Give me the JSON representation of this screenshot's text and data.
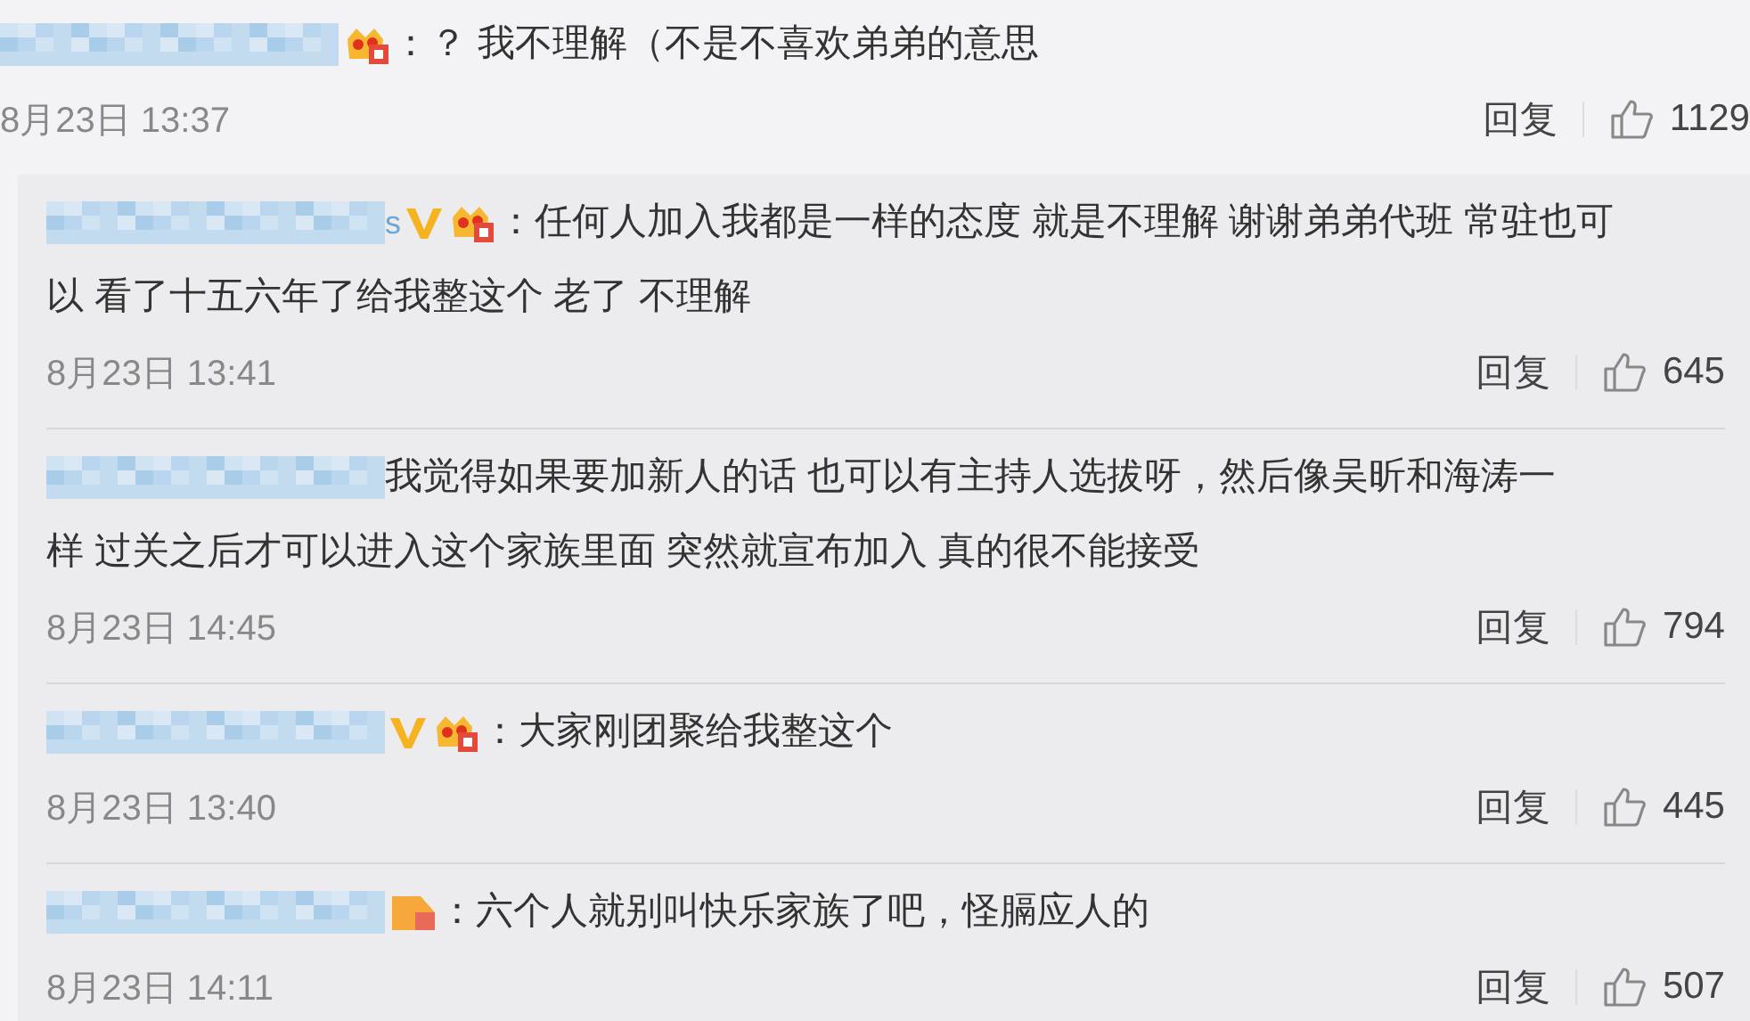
{
  "comment": {
    "badges": [
      {
        "kind": "crown"
      }
    ],
    "lines": [
      "：？ 我不理解（不是不喜欢弟弟的意思"
    ],
    "time": "8月23日 13:37",
    "reply_label": "回复",
    "likes": "1129"
  },
  "replies": [
    {
      "name_tail": "s",
      "badges": [
        {
          "kind": "verified"
        },
        {
          "kind": "crown"
        }
      ],
      "lines": [
        "：任何人加入我都是一样的态度 就是不理解 谢谢弟弟代班 常驻也可",
        "以 看了十五六年了给我整这个 老了 不理解"
      ],
      "time": "8月23日 13:41",
      "reply_label": "回复",
      "likes": "645"
    },
    {
      "lines": [
        "我觉得如果要加新人的话 也可以有主持人选拔呀，然后像吴昕和海涛一",
        "样 过关之后才可以进入这个家族里面 突然就宣布加入 真的很不能接受"
      ],
      "time": "8月23日 14:45",
      "reply_label": "回复",
      "likes": "794"
    },
    {
      "badges": [
        {
          "kind": "verified"
        },
        {
          "kind": "crown"
        }
      ],
      "lines": [
        "：大家刚团聚给我整这个"
      ],
      "time": "8月23日 13:40",
      "reply_label": "回复",
      "likes": "445"
    },
    {
      "badges": [
        {
          "kind": "member"
        }
      ],
      "lines": [
        "：六个人就别叫快乐家族了吧，怪膈应人的"
      ],
      "time": "8月23日 14:11",
      "reply_label": "回复",
      "likes": "507"
    }
  ]
}
